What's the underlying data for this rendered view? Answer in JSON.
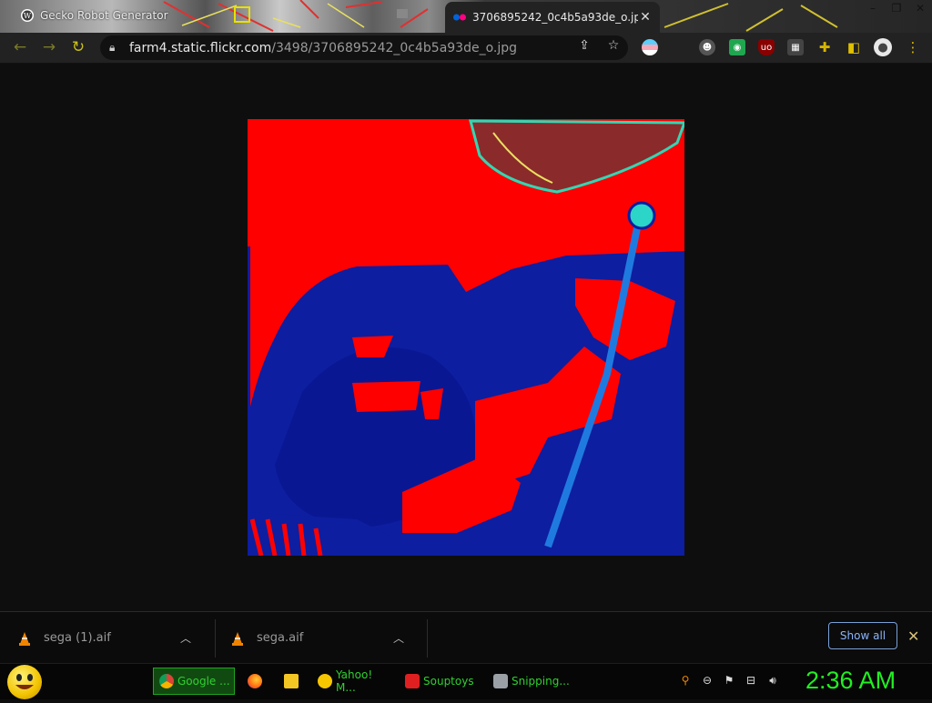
{
  "browser": {
    "tabs": [
      {
        "title": "Gecko Robot Generator",
        "active": false,
        "icon": "wordpress-icon"
      },
      {
        "title": "3706895242_0c4b5a93de_o.jpg",
        "active": true,
        "icon": "flickr-icon"
      }
    ],
    "address_bar": {
      "url_host": "farm4.static.flickr.com",
      "url_path": "/3498/3706895242_0c4b5a93de_o.jpg"
    }
  },
  "downloads": {
    "items": [
      {
        "filename": "sega (1).aif"
      },
      {
        "filename": "sega.aif"
      }
    ],
    "show_all_label": "Show all"
  },
  "taskbar": {
    "buttons": [
      {
        "label": "Google ...",
        "active": true
      },
      {
        "label": ""
      },
      {
        "label": ""
      },
      {
        "label": "Yahoo! M..."
      },
      {
        "label": "Souptoys"
      },
      {
        "label": "Snipping..."
      }
    ],
    "clock": "2:36 AM"
  },
  "colors": {
    "clock": "#22ee22",
    "taskbar_text": "#2fd12f",
    "show_all": "#8ab4f8",
    "image_red": "#ff0000",
    "image_blue": "#0a1a8c"
  }
}
